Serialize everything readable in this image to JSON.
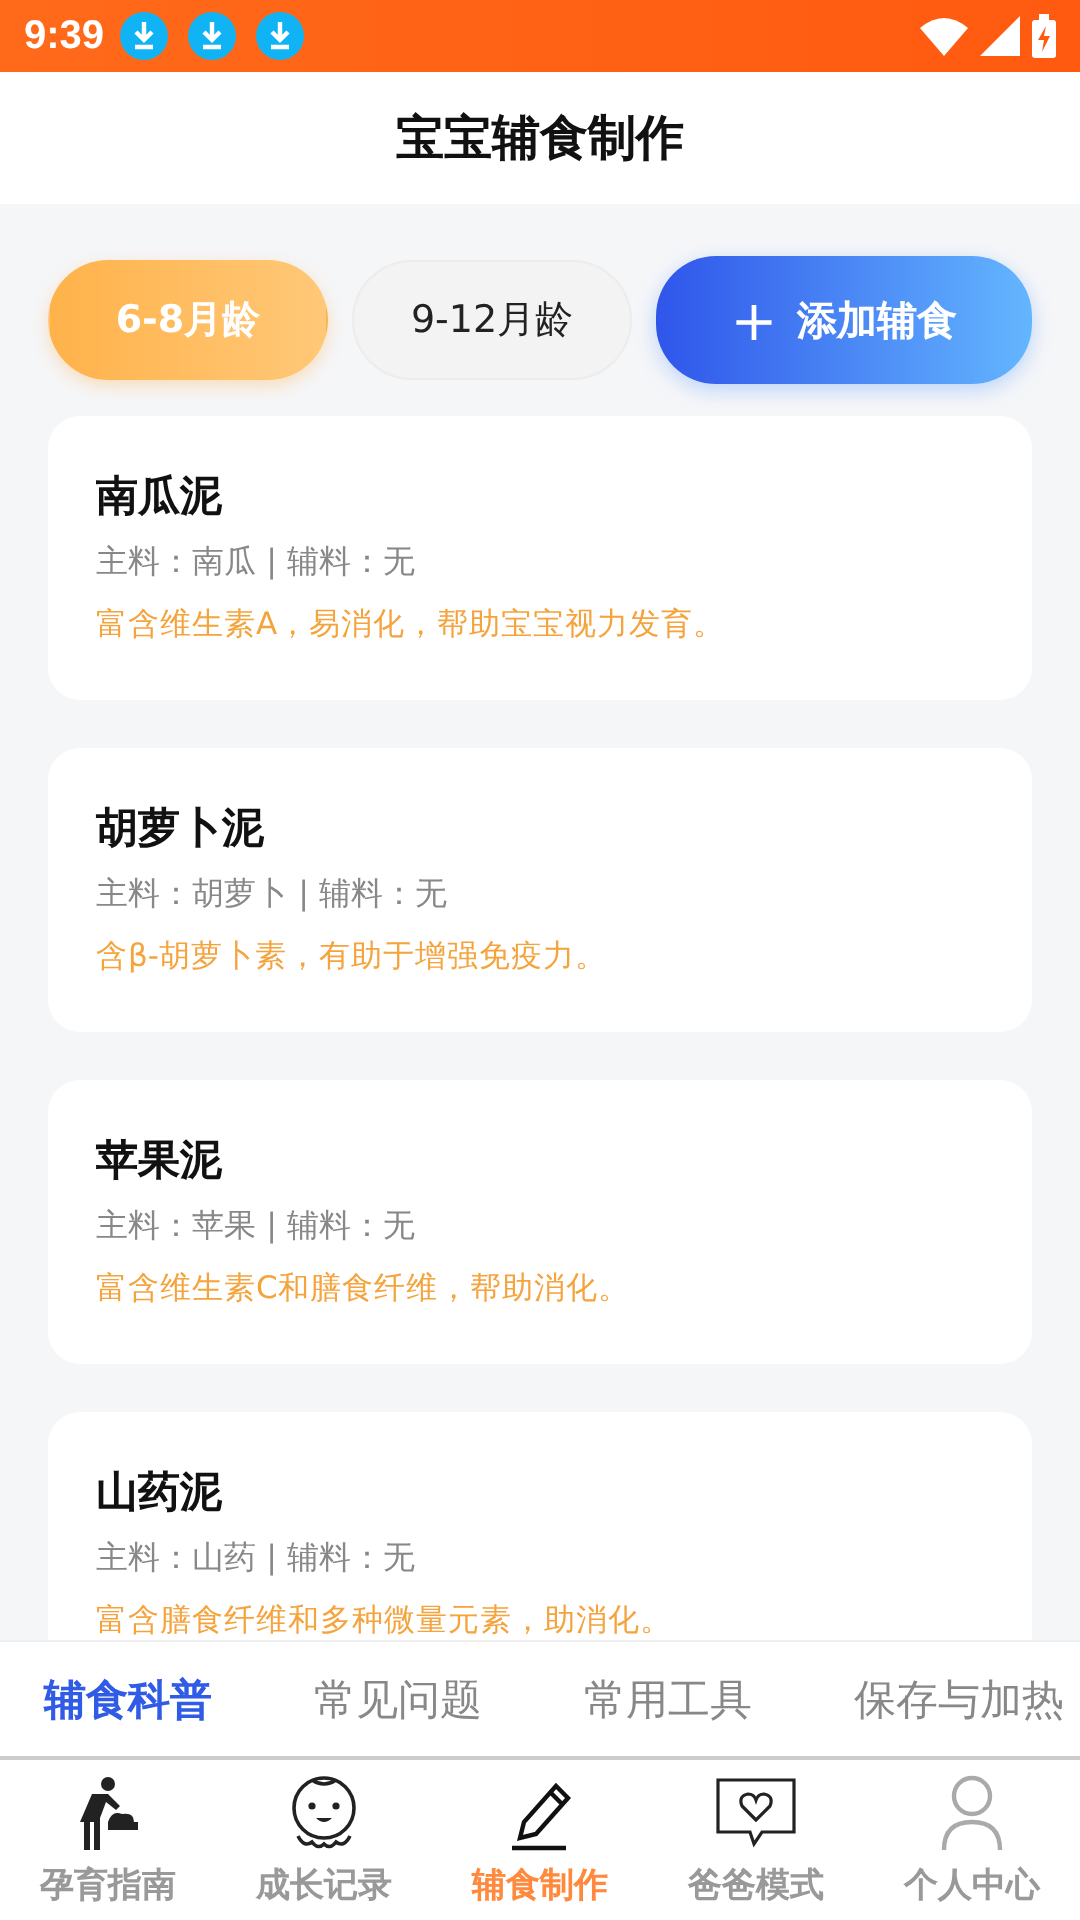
{
  "status_bar": {
    "time": "9:39",
    "notifications": [
      {
        "kind": "download"
      },
      {
        "kind": "download"
      },
      {
        "kind": "download"
      }
    ]
  },
  "header": {
    "title": "宝宝辅食制作"
  },
  "age_tabs": [
    {
      "label": "6-8月龄",
      "selected": true
    },
    {
      "label": "9-12月龄",
      "selected": false
    }
  ],
  "add_button": {
    "icon": "+",
    "label": "添加辅食"
  },
  "foods": [
    {
      "name": "南瓜泥",
      "ingredients": "主料：南瓜 | 辅料：无",
      "benefit": "富含维生素A，易消化，帮助宝宝视力发育。"
    },
    {
      "name": "胡萝卜泥",
      "ingredients": "主料：胡萝卜 | 辅料：无",
      "benefit": "含β-胡萝卜素，有助于增强免疫力。"
    },
    {
      "name": "苹果泥",
      "ingredients": "主料：苹果 | 辅料：无",
      "benefit": "富含维生素C和膳食纤维，帮助消化。"
    },
    {
      "name": "山药泥",
      "ingredients": "主料：山药 | 辅料：无",
      "benefit": "富含膳食纤维和多种微量元素，助消化。"
    }
  ],
  "sub_tabs": [
    {
      "label": "辅食科普",
      "selected": true
    },
    {
      "label": "常见问题",
      "selected": false
    },
    {
      "label": "常用工具",
      "selected": false
    },
    {
      "label": "保存与加热",
      "selected": false
    }
  ],
  "bottom_nav": [
    {
      "kind": "parenting",
      "label": "孕育指南",
      "selected": false
    },
    {
      "kind": "baby",
      "label": "成长记录",
      "selected": false
    },
    {
      "kind": "pencil",
      "label": "辅食制作",
      "selected": true
    },
    {
      "kind": "chat",
      "label": "爸爸模式",
      "selected": false
    },
    {
      "kind": "person",
      "label": "个人中心",
      "selected": false
    }
  ]
}
